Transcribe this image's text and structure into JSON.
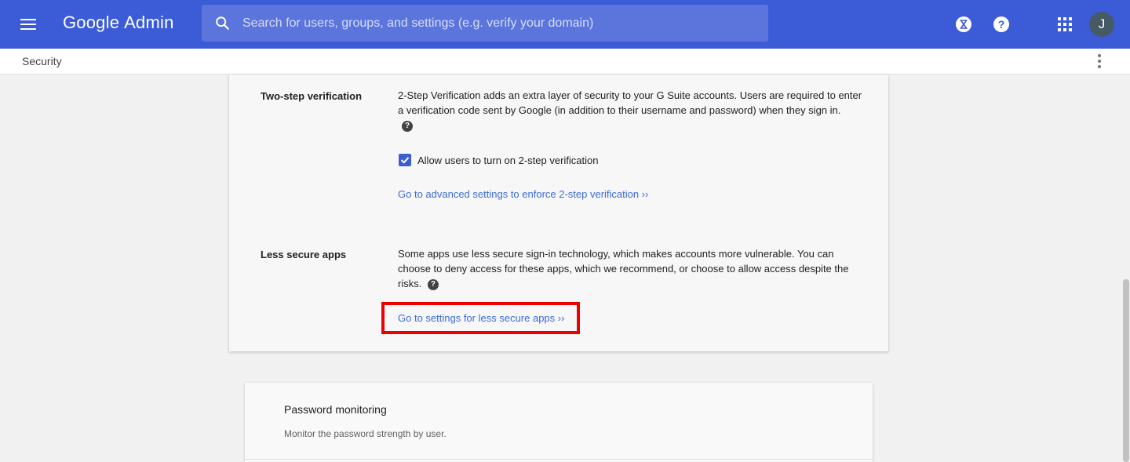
{
  "header": {
    "brand": "Google",
    "product": "Admin",
    "search_placeholder": "Search for users, groups, and settings (e.g. verify your domain)",
    "avatar_initial": "J"
  },
  "breadcrumb": {
    "current": "Security"
  },
  "two_step": {
    "label": "Two-step verification",
    "description": "2-Step Verification adds an extra layer of security to your G Suite accounts. Users are required to enter a verification code sent by Google (in addition to their username and password) when they sign in.",
    "help": "?",
    "checkbox_label": "Allow users to turn on 2-step verification",
    "checkbox_checked": true,
    "advanced_link": "Go to advanced settings to enforce 2-step verification ››"
  },
  "less_secure": {
    "label": "Less secure apps",
    "description": "Some apps use less secure sign-in technology, which makes accounts more vulnerable. You can choose to deny access for these apps, which we recommend, or choose to allow access despite the risks.",
    "help": "?",
    "settings_link": "Go to settings for less secure apps ››"
  },
  "password_monitoring": {
    "title": "Password monitoring",
    "description": "Monitor the password strength by user."
  },
  "colors": {
    "brand_blue": "#3c5bd6",
    "link_blue": "#3c6cd8",
    "highlight_red": "#ee0000"
  }
}
